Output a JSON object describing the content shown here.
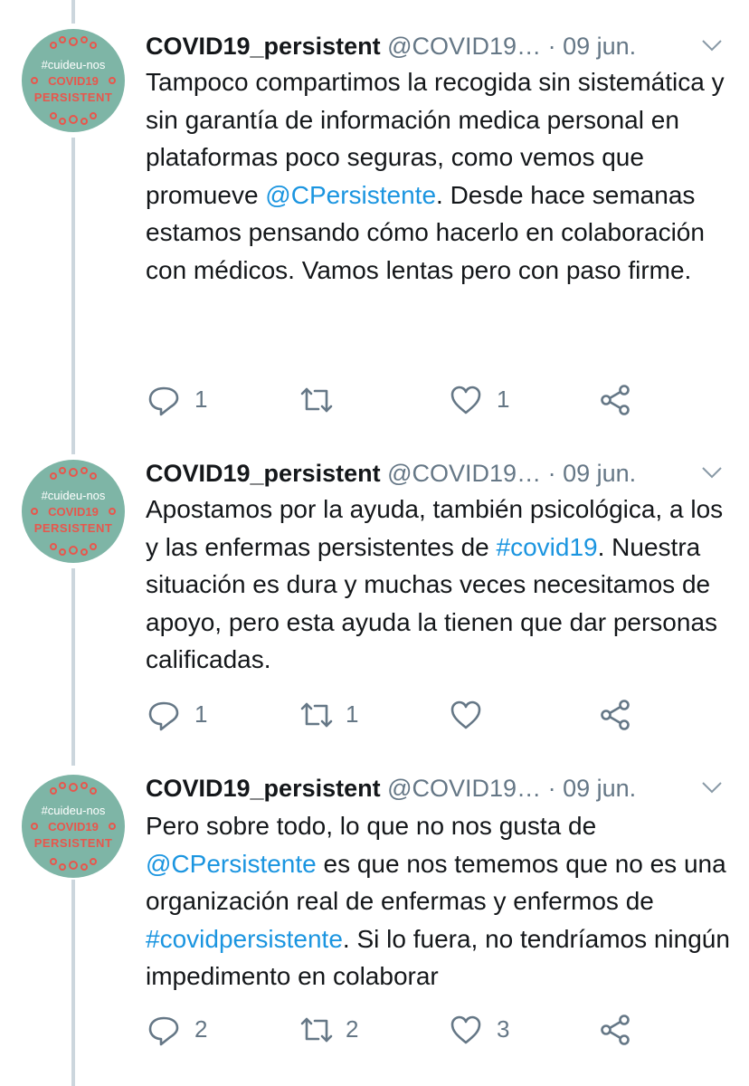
{
  "tweets": [
    {
      "avatar": {
        "hashtag": "#cuideu-nos",
        "line1": "COVID19",
        "line2": "PERSISTENT"
      },
      "display_name": "COVID19_persistent",
      "handle": "@COVID19…",
      "separator": "·",
      "date": "09 jun.",
      "text_parts": [
        {
          "text": "Tampoco compartimos la recogida sin sistemática y sin garantía de información medica personal en plataformas poco seguras, como vemos que promueve ",
          "kind": "plain"
        },
        {
          "text": "@CPersistente",
          "kind": "mention"
        },
        {
          "text": ". Desde hace semanas estamos pensando cómo hacerlo en colaboración con médicos. Vamos lentas pero con paso firme.",
          "kind": "plain"
        }
      ],
      "actions": {
        "reply": {
          "icon": "reply-icon",
          "count": "1"
        },
        "retweet": {
          "icon": "retweet-icon",
          "count": ""
        },
        "like": {
          "icon": "heart-icon",
          "count": "1"
        },
        "share": {
          "icon": "share-icon"
        }
      }
    },
    {
      "avatar": {
        "hashtag": "#cuideu-nos",
        "line1": "COVID19",
        "line2": "PERSISTENT"
      },
      "display_name": "COVID19_persistent",
      "handle": "@COVID19…",
      "separator": "·",
      "date": "09 jun.",
      "text_parts": [
        {
          "text": "Apostamos por la ayuda, también psicológica, a los y las enfermas persistentes de ",
          "kind": "plain"
        },
        {
          "text": "#covid19",
          "kind": "tag"
        },
        {
          "text": ". Nuestra situación es dura y muchas veces necesitamos de apoyo, pero esta ayuda la tienen que dar personas calificadas.",
          "kind": "plain"
        }
      ],
      "actions": {
        "reply": {
          "icon": "reply-icon",
          "count": "1"
        },
        "retweet": {
          "icon": "retweet-icon",
          "count": "1"
        },
        "like": {
          "icon": "heart-icon",
          "count": ""
        },
        "share": {
          "icon": "share-icon"
        }
      }
    },
    {
      "avatar": {
        "hashtag": "#cuideu-nos",
        "line1": "COVID19",
        "line2": "PERSISTENT"
      },
      "display_name": "COVID19_persistent",
      "handle": "@COVID19…",
      "separator": "·",
      "date": "09 jun.",
      "text_parts": [
        {
          "text": "Pero sobre todo, lo que no nos gusta de ",
          "kind": "plain"
        },
        {
          "text": "@CPersistente",
          "kind": "mention"
        },
        {
          "text": " es que nos tememos que no es una organización real de enfermas y enfermos de ",
          "kind": "plain"
        },
        {
          "text": "#covidpersistente",
          "kind": "tag"
        },
        {
          "text": ". Si lo fuera, no tendríamos ningún impedimento en colaborar",
          "kind": "plain"
        }
      ],
      "actions": {
        "reply": {
          "icon": "reply-icon",
          "count": "2"
        },
        "retweet": {
          "icon": "retweet-icon",
          "count": "2"
        },
        "like": {
          "icon": "heart-icon",
          "count": "3"
        },
        "share": {
          "icon": "share-icon"
        }
      }
    }
  ],
  "colors": {
    "text": "#14171a",
    "secondary": "#657786",
    "link": "#1b95e0",
    "thread_line": "#ccd6dd",
    "avatar_bg": "#7eb5a6",
    "avatar_accent": "#e8564c"
  }
}
